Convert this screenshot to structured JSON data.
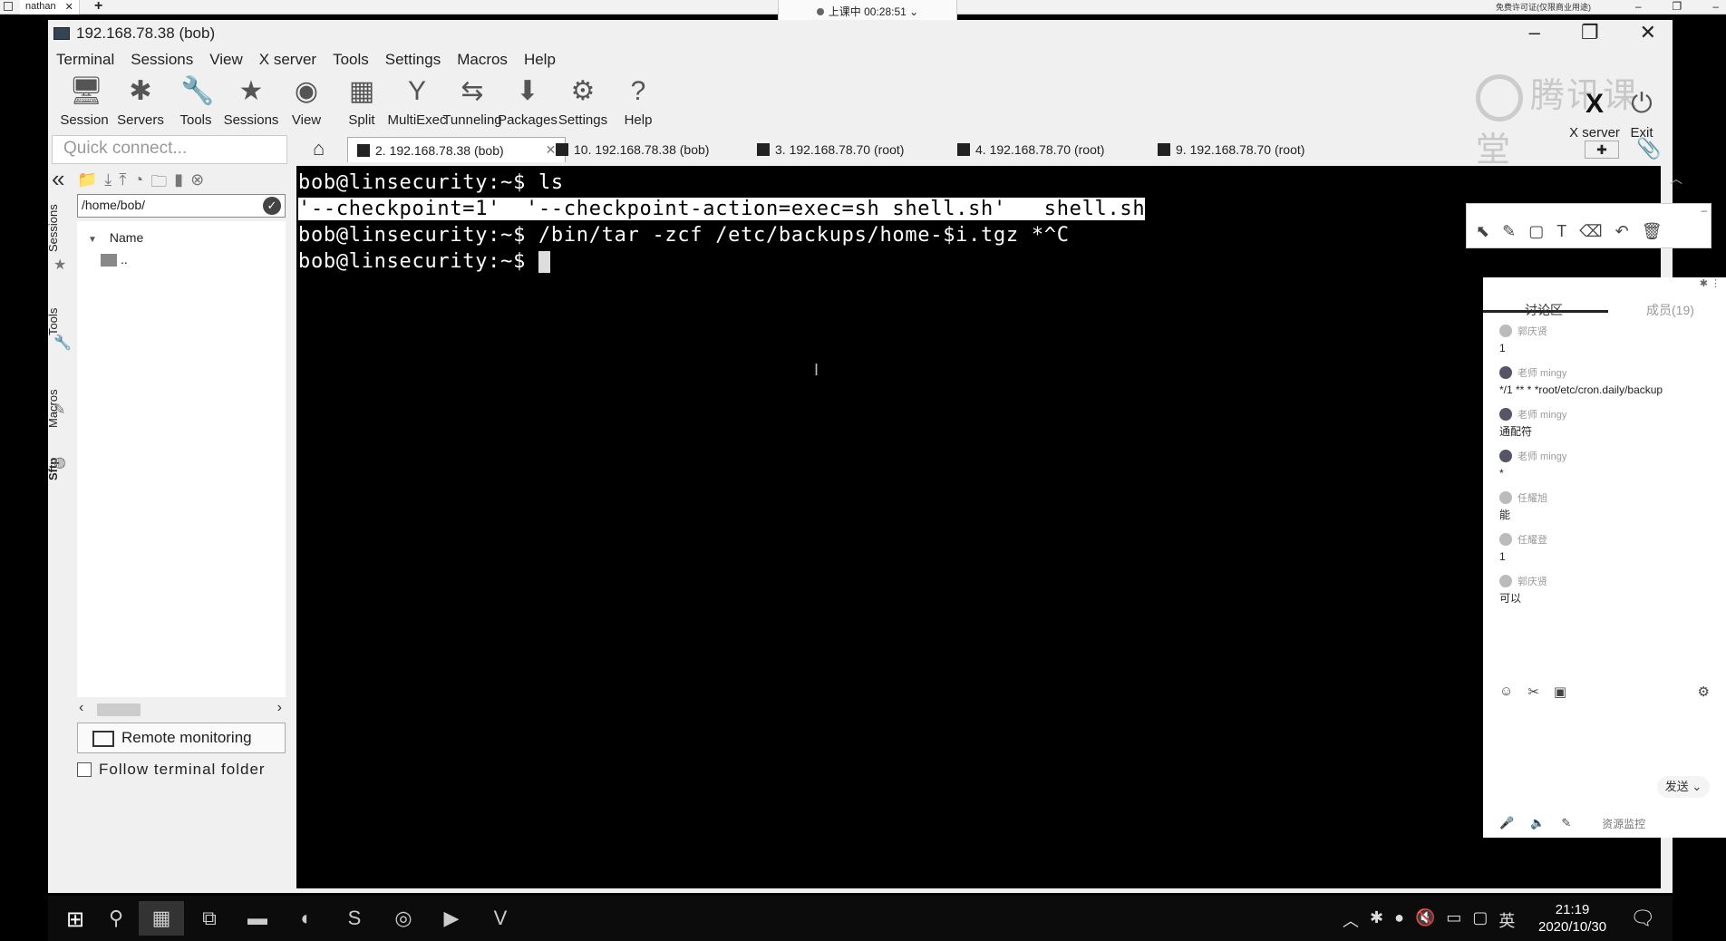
{
  "host": {
    "tab_label": "nathan",
    "tab_close": "✕",
    "plus": "+",
    "recording": "上课中 00:28:51",
    "right_text": "免费许可证(仅限商业用途)",
    "ctrl_min": "–",
    "ctrl_restore": "❐",
    "ctrl_close": "–"
  },
  "window": {
    "title": "192.168.78.38 (bob)",
    "ctrl_min": "–",
    "ctrl_max": "❐",
    "ctrl_close": "✕"
  },
  "menu": [
    "Terminal",
    "Sessions",
    "View",
    "X server",
    "Tools",
    "Settings",
    "Macros",
    "Help"
  ],
  "toolbar": [
    {
      "label": "Session",
      "icon": "🖥"
    },
    {
      "label": "Servers",
      "icon": "✱"
    },
    {
      "label": "Tools",
      "icon": "🔧"
    },
    {
      "label": "Sessions",
      "icon": "★"
    },
    {
      "label": "View",
      "icon": "◉"
    },
    {
      "label": "Split",
      "icon": "▦"
    },
    {
      "label": "MultiExec",
      "icon": "Y"
    },
    {
      "label": "Tunneling",
      "icon": "⇆"
    },
    {
      "label": "Packages",
      "icon": "⬇"
    },
    {
      "label": "Settings",
      "icon": "⚙"
    },
    {
      "label": "Help",
      "icon": "?"
    }
  ],
  "xserver": {
    "label": "X server",
    "icon": "X"
  },
  "exit": {
    "label": "Exit",
    "icon": "⏻"
  },
  "brand": "腾讯课堂",
  "quick_connect_placeholder": "Quick connect...",
  "tabs": [
    {
      "label": "2. 192.168.78.38 (bob)",
      "close": "✕"
    },
    {
      "label": "10. 192.168.78.38 (bob)"
    },
    {
      "label": "3. 192.168.78.70 (root)"
    },
    {
      "label": "4. 192.168.78.70 (root)"
    },
    {
      "label": "9. 192.168.78.70 (root)"
    }
  ],
  "sidebar": {
    "collapse_icon": "«",
    "vtabs": [
      "Sessions",
      "Tools",
      "Macros",
      "Sftp"
    ],
    "path": "/home/bob/",
    "column_name": "Name",
    "sort_icon": "▼",
    "row_parent": "..",
    "scroll_left": "‹",
    "scroll_right": "›",
    "remote_monitoring": "Remote monitoring",
    "follow_folder": "Follow terminal folder"
  },
  "terminal": {
    "line1": "bob@linsecurity:~$ ls",
    "line2": "'--checkpoint=1'  '--checkpoint-action=exec=sh shell.sh'   shell.sh",
    "line3": "bob@linsecurity:~$ /bin/tar -zcf /etc/backups/home-$i.tgz *^C",
    "line4": "bob@linsecurity:~$ "
  },
  "chat": {
    "tab_discussion": "讨论区",
    "tab_members": "成员(19)",
    "messages": [
      {
        "user": "郭庆贤",
        "text": "1"
      },
      {
        "user": "老师 mingy",
        "text": "*/1 ** * *root/etc/cron.daily/backup"
      },
      {
        "user": "老师 mingy",
        "text": "通配符"
      },
      {
        "user": "老师 mingy",
        "text": "*"
      },
      {
        "user": "任耀旭",
        "text": "能"
      },
      {
        "user": "任耀登",
        "text": "1"
      },
      {
        "user": "郭庆贤",
        "text": "可以"
      }
    ],
    "send": "发送",
    "resource_monitor": "资源监控"
  },
  "taskbar": {
    "time": "21:19",
    "date": "2020/10/30",
    "ime": "英"
  }
}
